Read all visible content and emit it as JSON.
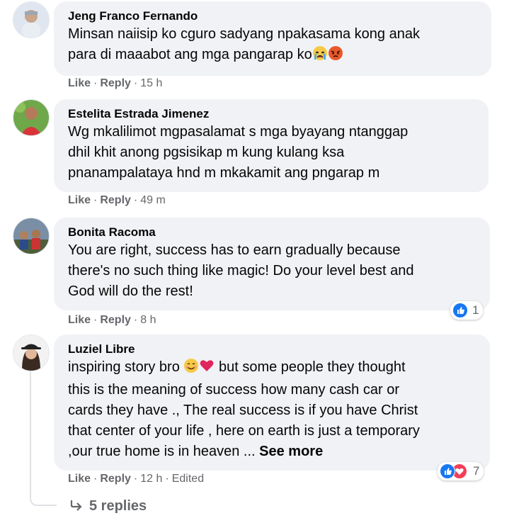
{
  "comments": [
    {
      "author": "Jeng Franco Fernando",
      "text": "Minsan naiisip ko cguro sadyang npakasama kong anak\npara di maaabot ang mga pangarap ko",
      "like": "Like",
      "reply": "Reply",
      "time": "15 h"
    },
    {
      "author": "Estelita Estrada Jimenez",
      "text": "Wg mkalilimot mgpasalamat s mga byayang ntanggap\ndhil khit anong pgsisikap m kung kulang ksa\npnanampalataya hnd m mkakamit ang pngarap m",
      "like": "Like",
      "reply": "Reply",
      "time": "49 m"
    },
    {
      "author": "Bonita Racoma",
      "text": "You are right, success has to earn gradually because\nthere's no such thing like magic! Do your level best and\nGod will do the rest!",
      "like": "Like",
      "reply": "Reply",
      "time": "8 h",
      "reaction_count": "1"
    },
    {
      "author": "Luziel Libre",
      "text_line1": "inspiring story bro",
      "text_rest": "but some people they thought\nthis is the meaning of success how many cash car or\ncards they have ., The real success is if you have Christ\nthat center of your life , here on earth is just a temporary\n,our true home is in heaven ... ",
      "see_more": "See more",
      "like": "Like",
      "reply": "Reply",
      "time": "12 h",
      "edited": "Edited",
      "reaction_count": "7"
    }
  ],
  "replies_link": "5 replies",
  "icons": {
    "like": "like-icon",
    "love": "love-icon",
    "reply_arrow": "reply-arrow-icon"
  },
  "colors": {
    "like_blue": "#1877f2",
    "love_red": "#f33e58",
    "bubble": "#f0f2f5",
    "meta": "#65676b"
  }
}
